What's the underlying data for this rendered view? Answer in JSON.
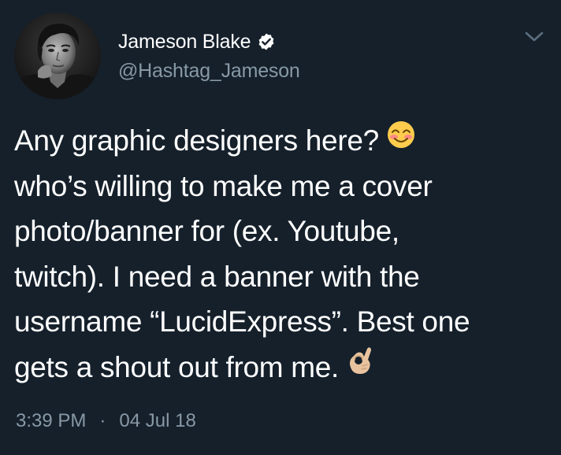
{
  "author": {
    "display_name": "Jameson Blake",
    "handle": "@Hashtag_Jameson",
    "verified": true,
    "avatar_icon": "profile-photo"
  },
  "menu": {
    "icon": "chevron-down-icon"
  },
  "tweet": {
    "lines": [
      "Any graphic designers here?",
      "who’s willing to make me a cover",
      "photo/banner for (ex. Youtube,",
      "twitch). I need a banner with the",
      "username “LucidExpress”. Best one",
      "gets a shout out from me."
    ],
    "emojis": {
      "after_line_1": "smiling-face-with-smiling-eyes-emoji",
      "after_line_6": "ok-hand-emoji"
    }
  },
  "meta": {
    "time": "3:39 PM",
    "separator": "·",
    "date": "04 Jul 18"
  },
  "colors": {
    "background": "#15202b",
    "primary_text": "#ffffff",
    "secondary_text": "#8899a6"
  }
}
